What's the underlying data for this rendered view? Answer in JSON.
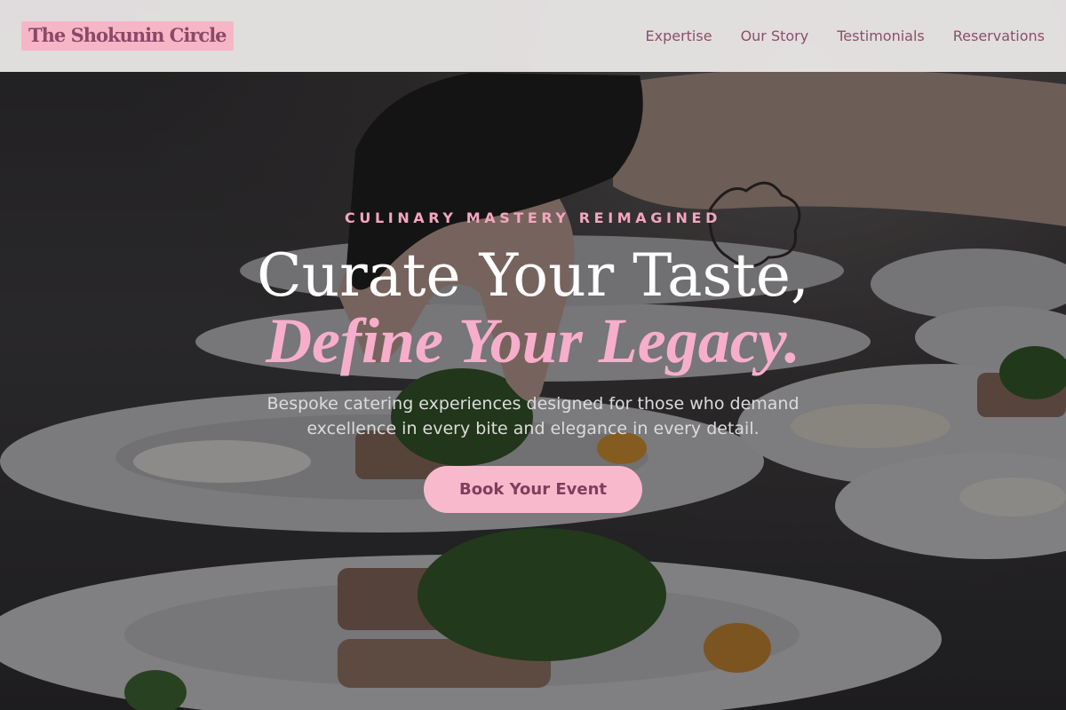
{
  "brand": {
    "logo_text": "The Shokunin Circle",
    "accent_pink": "#f7b6c8",
    "accent_mauve": "#8b4f6b"
  },
  "nav": {
    "items": [
      {
        "label": "Expertise"
      },
      {
        "label": "Our Story"
      },
      {
        "label": "Testimonials"
      },
      {
        "label": "Reservations"
      }
    ]
  },
  "hero": {
    "eyebrow": "CULINARY MASTERY REIMAGINED",
    "headline_line1": "Curate Your Taste,",
    "headline_line2": "Define Your Legacy.",
    "subtitle": "Bespoke catering experiences designed for those who demand excellence in every bite and elegance in every detail.",
    "cta_label": "Book Your Event",
    "background_image": "plated-dishes-kitchen-photo"
  }
}
